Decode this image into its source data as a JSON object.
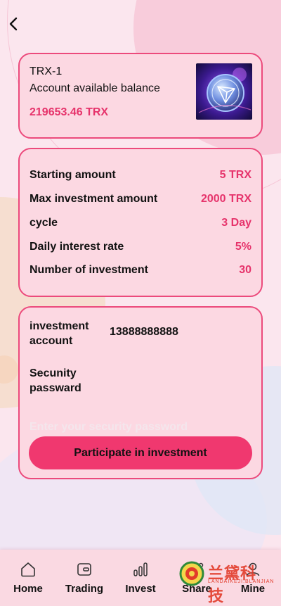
{
  "nav": {
    "back_icon": "chevron-left-icon"
  },
  "product": {
    "name": "TRX-1",
    "balance_label": "Account available balance",
    "balance_value": "219653.46 TRX",
    "image": "trx-coin-image"
  },
  "details": [
    {
      "label": "Starting amount",
      "value": "5 TRX"
    },
    {
      "label": "Max investment amount",
      "value": "2000 TRX"
    },
    {
      "label": "cycle",
      "value": "3 Day"
    },
    {
      "label": "Daily interest rate",
      "value": "5%"
    },
    {
      "label": "Number of investment",
      "value": "30"
    }
  ],
  "form": {
    "account_label": "investment account",
    "account_value": "13888888888",
    "password_label": "Secunity passward",
    "password_placeholder": "Enter your security password",
    "password_value": "",
    "submit_label": "Participate in investment"
  },
  "tabbar": [
    {
      "label": "Home",
      "icon": "home-icon"
    },
    {
      "label": "Trading",
      "icon": "wallet-icon"
    },
    {
      "label": "Invest",
      "icon": "bar-chart-icon"
    },
    {
      "label": "Share",
      "icon": "share-icon"
    },
    {
      "label": "Mine",
      "icon": "user-icon"
    }
  ],
  "watermark": {
    "text": "兰黛科技",
    "sub": "LANDAIKEJI.BLANJIAN"
  },
  "colors": {
    "accent": "#e6336b",
    "button": "#f0386f",
    "card_bg": "#fcd8e2",
    "card_border": "#ec4a7c"
  }
}
